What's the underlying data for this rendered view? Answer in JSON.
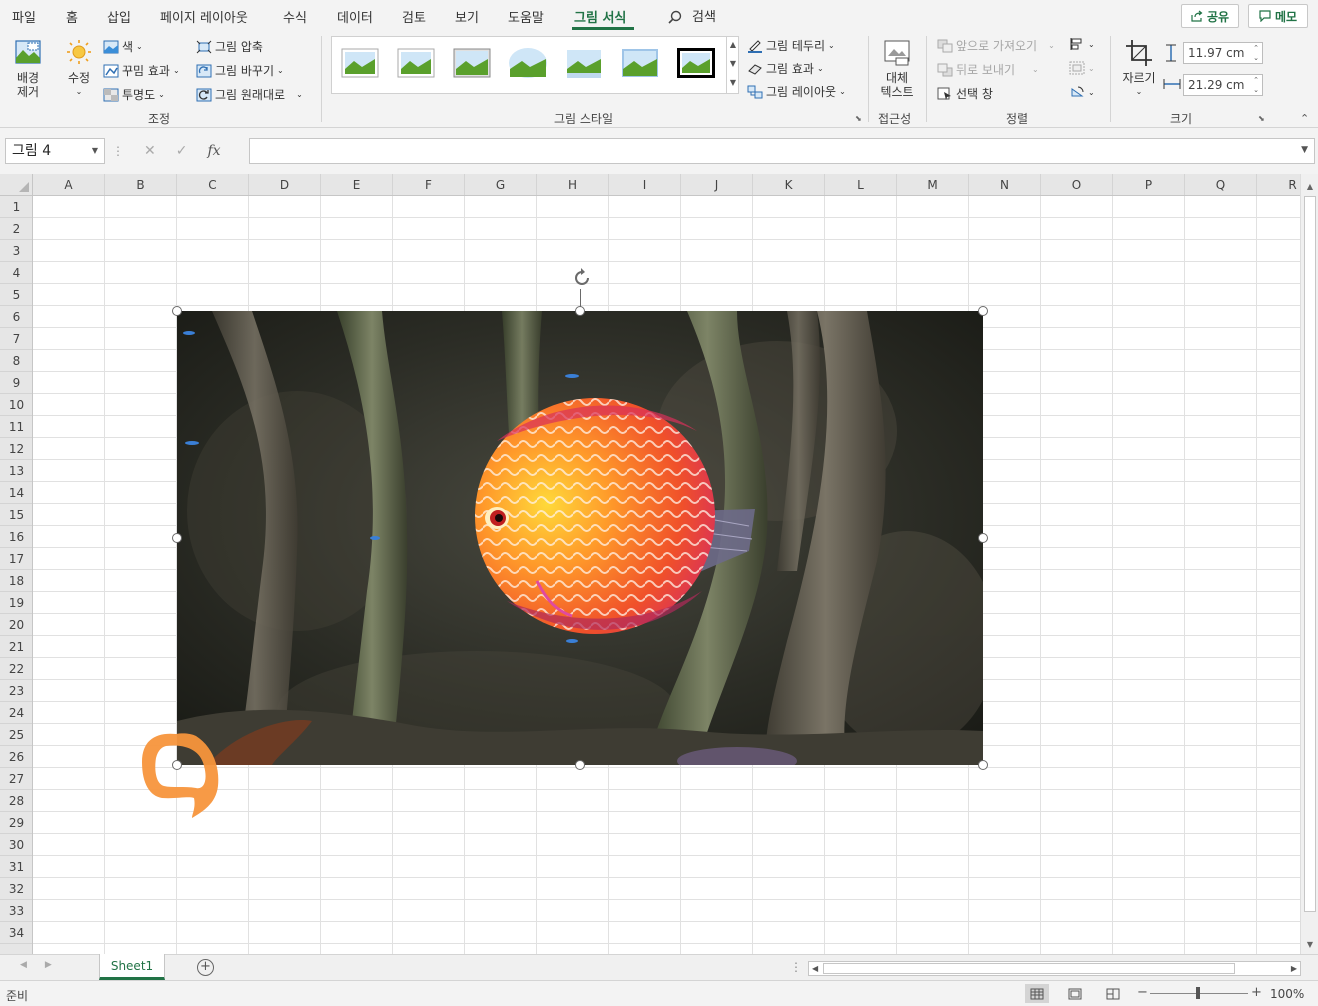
{
  "menu": {
    "tabs": [
      "파일",
      "홈",
      "삽입",
      "페이지 레이아웃",
      "수식",
      "데이터",
      "검토",
      "보기",
      "도움말",
      "그림 서식"
    ],
    "active_tab": "그림 서식",
    "search_label": "검색",
    "share_label": "공유",
    "memo_label": "메모"
  },
  "ribbon": {
    "remove_bg": [
      "배경",
      "제거"
    ],
    "corrections": "수정",
    "color": "색",
    "artistic_effects": "꾸밈 효과",
    "transparency": "투명도",
    "compress": "그림 압축",
    "change_picture": "그림 바꾸기",
    "reset_picture": "그림 원래대로",
    "adjust_group": "조정",
    "picture_border": "그림 테두리",
    "picture_effects": "그림 효과",
    "picture_layout": "그림 레이아웃",
    "styles_group": "그림 스타일",
    "alt_text": [
      "대체",
      "텍스트"
    ],
    "accessibility_group": "접근성",
    "bring_forward": "앞으로 가져오기",
    "send_backward": "뒤로 보내기",
    "selection_pane": "선택 창",
    "arrange_group": "정렬",
    "crop": "자르기",
    "height": "11.97 cm",
    "width": "21.29 cm",
    "size_group": "크기"
  },
  "formula_bar": {
    "name_box": "그림 4",
    "fx": "fx",
    "cancel": "✕",
    "enter": "✓",
    "value": ""
  },
  "grid": {
    "columns": [
      "A",
      "B",
      "C",
      "D",
      "E",
      "F",
      "G",
      "H",
      "I",
      "J",
      "K",
      "L",
      "M",
      "N",
      "O",
      "P",
      "Q",
      "R"
    ],
    "rows": [
      "1",
      "2",
      "3",
      "4",
      "5",
      "6",
      "7",
      "8",
      "9",
      "10",
      "11",
      "12",
      "13",
      "14",
      "15",
      "16",
      "17",
      "18",
      "19",
      "20",
      "21",
      "22",
      "23",
      "24",
      "25",
      "26",
      "27",
      "28",
      "29",
      "30",
      "31",
      "32",
      "33",
      "34"
    ]
  },
  "picture": {
    "name": "그림 4",
    "subject": "orange discus fish in aquarium"
  },
  "sheets": {
    "tabs": [
      "Sheet1"
    ],
    "active": "Sheet1",
    "add": "+"
  },
  "status": {
    "ready": "준비",
    "zoom": "100%"
  },
  "colors": {
    "accent": "#217346",
    "annotation": "#f7953c"
  }
}
